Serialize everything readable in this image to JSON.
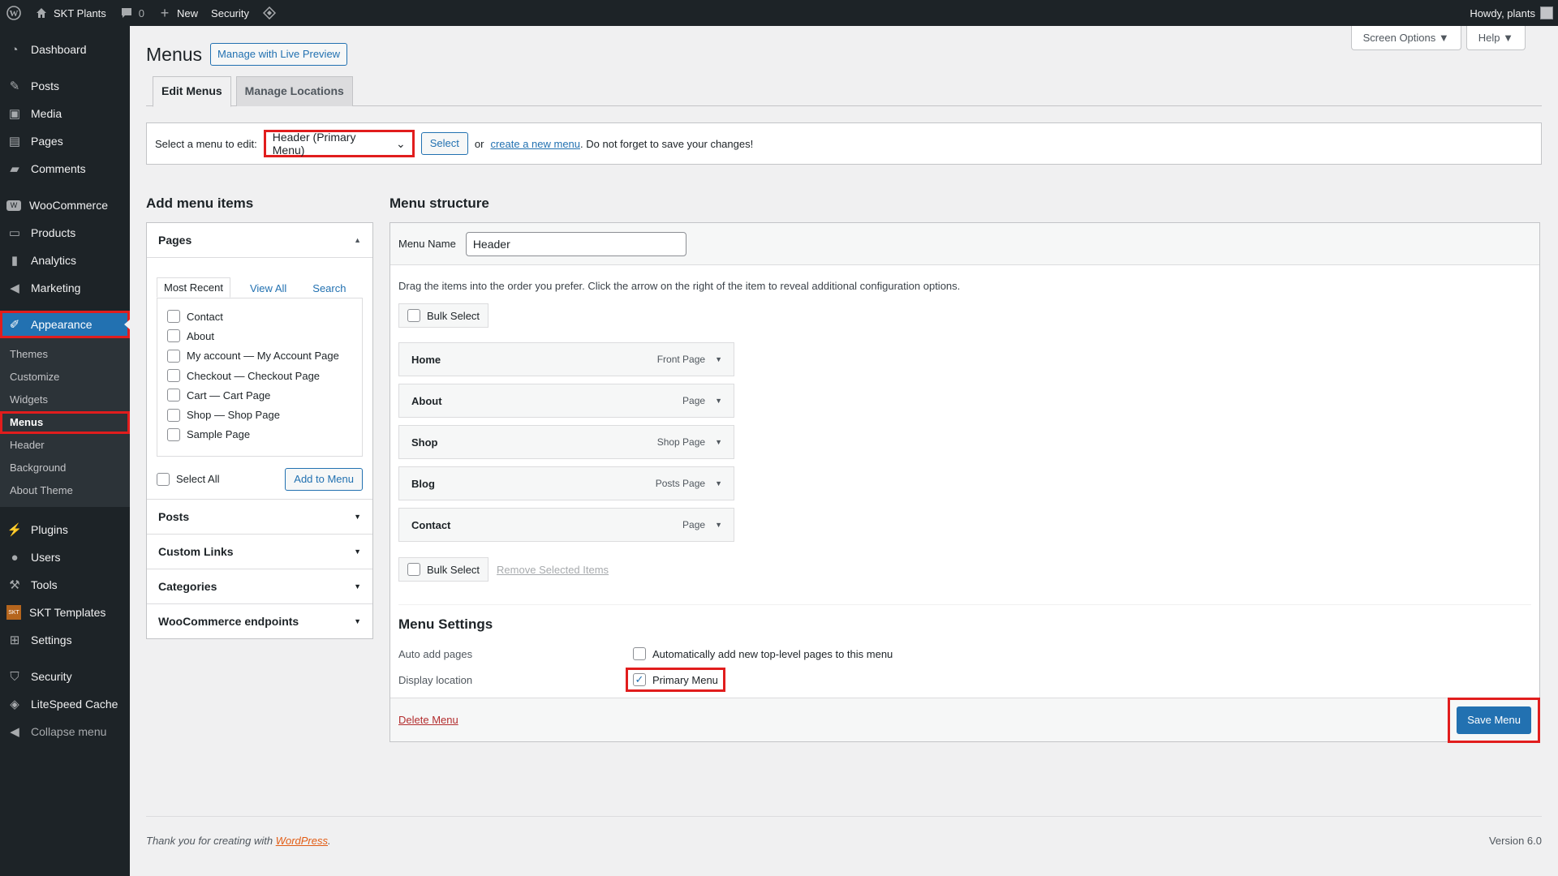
{
  "adminbar": {
    "site_name": "SKT Plants",
    "comments_count": "0",
    "new_label": "New",
    "security_label": "Security",
    "howdy": "Howdy, plants"
  },
  "sidebar": {
    "items": [
      {
        "label": "Dashboard",
        "icon": "dashboard-icon"
      },
      {
        "label": "Posts",
        "icon": "pin-icon"
      },
      {
        "label": "Media",
        "icon": "media-icon"
      },
      {
        "label": "Pages",
        "icon": "pages-icon"
      },
      {
        "label": "Comments",
        "icon": "comment-icon"
      },
      {
        "label": "WooCommerce",
        "icon": "woo-icon"
      },
      {
        "label": "Products",
        "icon": "archive-icon"
      },
      {
        "label": "Analytics",
        "icon": "chart-icon"
      },
      {
        "label": "Marketing",
        "icon": "megaphone-icon"
      },
      {
        "label": "Appearance",
        "icon": "brush-icon"
      },
      {
        "label": "Plugins",
        "icon": "plug-icon"
      },
      {
        "label": "Users",
        "icon": "user-icon"
      },
      {
        "label": "Tools",
        "icon": "wrench-icon"
      },
      {
        "label": "SKT Templates",
        "icon": "skt-icon"
      },
      {
        "label": "Settings",
        "icon": "settings-icon"
      },
      {
        "label": "Security",
        "icon": "shield-icon"
      },
      {
        "label": "LiteSpeed Cache",
        "icon": "diamond-icon"
      },
      {
        "label": "Collapse menu",
        "icon": "collapse-icon"
      }
    ],
    "appearance_sub": [
      "Themes",
      "Customize",
      "Widgets",
      "Menus",
      "Header",
      "Background",
      "About Theme"
    ]
  },
  "header": {
    "title": "Menus",
    "live_preview": "Manage with Live Preview",
    "screen_options": "Screen Options",
    "help": "Help"
  },
  "tabs": [
    "Edit Menus",
    "Manage Locations"
  ],
  "select_bar": {
    "label": "Select a menu to edit:",
    "selected": "Header (Primary Menu)",
    "select_btn": "Select",
    "or": "or",
    "create_link": "create a new menu",
    "note": ". Do not forget to save your changes!"
  },
  "add_items": {
    "heading": "Add menu items",
    "pages_title": "Pages",
    "subtabs": [
      "Most Recent",
      "View All",
      "Search"
    ],
    "pages": [
      "Contact",
      "About",
      "My account — My Account Page",
      "Checkout — Checkout Page",
      "Cart — Cart Page",
      "Shop — Shop Page",
      "Sample Page"
    ],
    "select_all": "Select All",
    "add_btn": "Add to Menu",
    "sections": [
      "Posts",
      "Custom Links",
      "Categories",
      "WooCommerce endpoints"
    ]
  },
  "structure": {
    "heading": "Menu structure",
    "name_label": "Menu Name",
    "name_value": "Header",
    "instructions": "Drag the items into the order you prefer. Click the arrow on the right of the item to reveal additional configuration options.",
    "bulk_select": "Bulk Select",
    "items": [
      {
        "label": "Home",
        "type": "Front Page"
      },
      {
        "label": "About",
        "type": "Page"
      },
      {
        "label": "Shop",
        "type": "Shop Page"
      },
      {
        "label": "Blog",
        "type": "Posts Page"
      },
      {
        "label": "Contact",
        "type": "Page"
      }
    ],
    "remove_selected": "Remove Selected Items",
    "settings_title": "Menu Settings",
    "auto_add_label": "Auto add pages",
    "auto_add_text": "Automatically add new top-level pages to this menu",
    "display_location_label": "Display location",
    "primary_menu": "Primary Menu",
    "delete": "Delete Menu",
    "save": "Save Menu"
  },
  "footer": {
    "thanks": "Thank you for creating with",
    "wp_link": "WordPress",
    "version": "Version 6.0"
  }
}
